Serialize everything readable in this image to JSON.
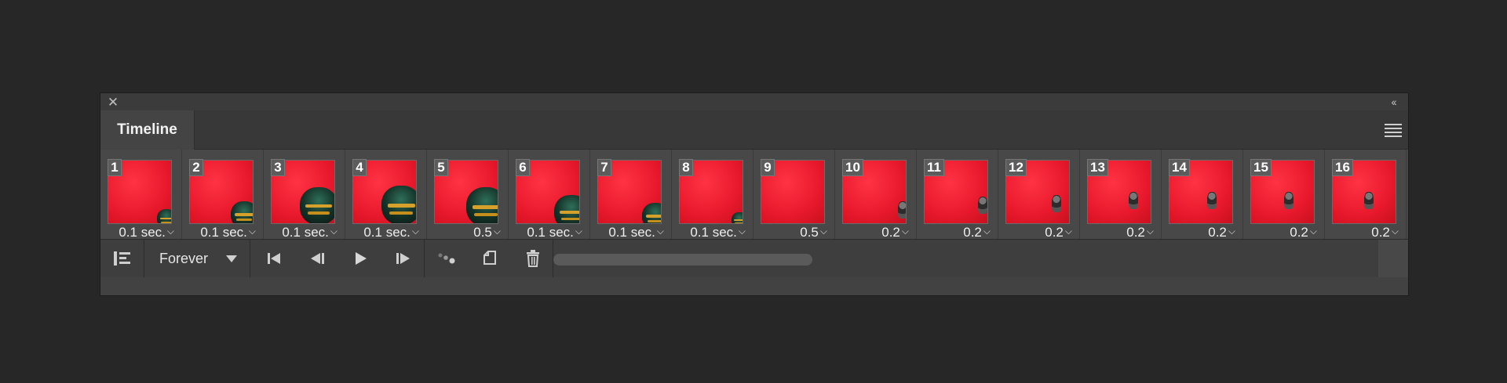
{
  "panel": {
    "tab_label": "Timeline",
    "close_icon": "close-icon",
    "collapse_icon": "collapse-icon",
    "menu_icon": "panel-menu-icon"
  },
  "frames": [
    {
      "number": "1",
      "delay": "0.1 sec."
    },
    {
      "number": "2",
      "delay": "0.1 sec."
    },
    {
      "number": "3",
      "delay": "0.1 sec."
    },
    {
      "number": "4",
      "delay": "0.1 sec."
    },
    {
      "number": "5",
      "delay": "0.5"
    },
    {
      "number": "6",
      "delay": "0.1 sec."
    },
    {
      "number": "7",
      "delay": "0.1 sec."
    },
    {
      "number": "8",
      "delay": "0.1 sec."
    },
    {
      "number": "9",
      "delay": "0.5"
    },
    {
      "number": "10",
      "delay": "0.2"
    },
    {
      "number": "11",
      "delay": "0.2"
    },
    {
      "number": "12",
      "delay": "0.2"
    },
    {
      "number": "13",
      "delay": "0.2"
    },
    {
      "number": "14",
      "delay": "0.2"
    },
    {
      "number": "15",
      "delay": "0.2"
    },
    {
      "number": "16",
      "delay": "0.2"
    }
  ],
  "toolbar": {
    "loop_option": "Forever",
    "icons": [
      "convert-to-video-timeline-icon",
      "first-frame-icon",
      "previous-frame-icon",
      "play-icon",
      "next-frame-icon",
      "tween-icon",
      "duplicate-frame-icon",
      "delete-frame-icon"
    ]
  },
  "colors": {
    "frame_background": "#ec1c2e",
    "panel": "#424242",
    "app_background": "#272727"
  }
}
